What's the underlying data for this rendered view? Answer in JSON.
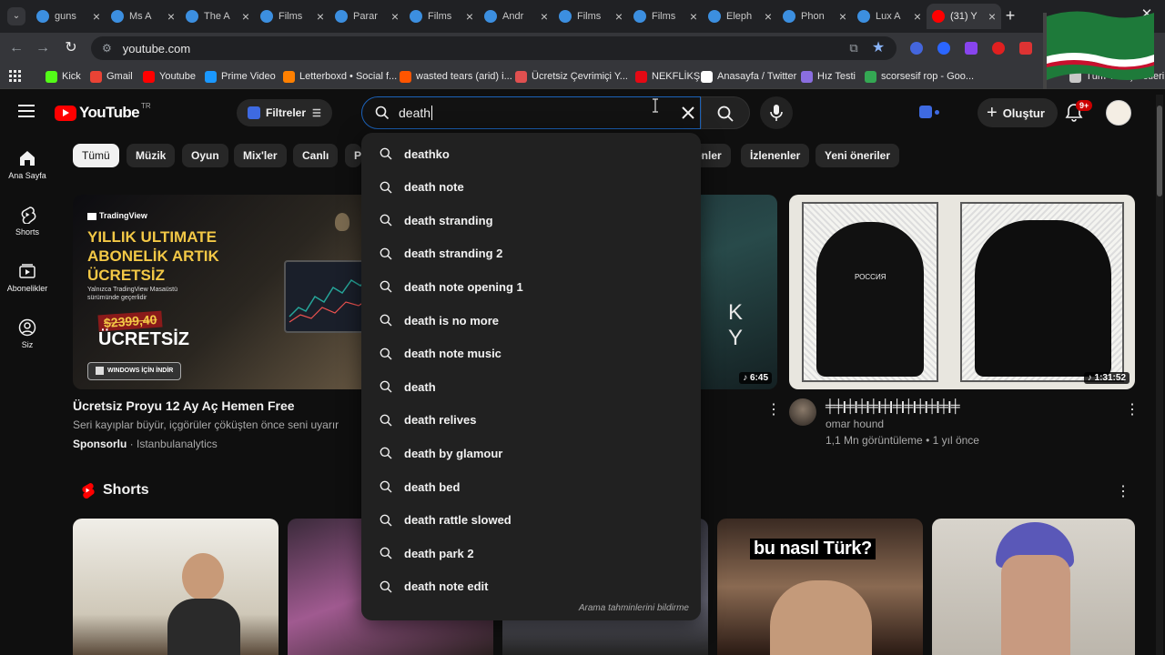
{
  "browser": {
    "tabs": [
      {
        "title": "guns",
        "color": "#3c8fe0"
      },
      {
        "title": "Ms A",
        "color": "#3c8fe0"
      },
      {
        "title": "The A",
        "color": "#3c8fe0"
      },
      {
        "title": "Films",
        "color": "#3c8fe0"
      },
      {
        "title": "Parar",
        "color": "#3c8fe0"
      },
      {
        "title": "Films",
        "color": "#3c8fe0"
      },
      {
        "title": "Andr",
        "color": "#3c8fe0"
      },
      {
        "title": "Films",
        "color": "#3c8fe0"
      },
      {
        "title": "Films",
        "color": "#3c8fe0"
      },
      {
        "title": "Eleph",
        "color": "#3c8fe0"
      },
      {
        "title": "Phon",
        "color": "#3c8fe0"
      },
      {
        "title": "Lux A",
        "color": "#3c8fe0"
      },
      {
        "title": "(31) Y",
        "color": "#ff0000",
        "active": true
      }
    ],
    "address": "youtube.com",
    "bookmarks": [
      {
        "label": "Kick",
        "color": "#53fc18"
      },
      {
        "label": "Gmail",
        "color": "#ea4335"
      },
      {
        "label": "Youtube",
        "color": "#ff0000"
      },
      {
        "label": "Prime Video",
        "color": "#1a98ff"
      },
      {
        "label": "Letterboxd • Social f...",
        "color": "#ff8000"
      },
      {
        "label": "wasted tears (arid) i...",
        "color": "#ff5500"
      },
      {
        "label": "Ücretsiz Çevrimiçi Y...",
        "color": "#e05050"
      },
      {
        "label": "NEKFLİKŞ",
        "color": "#e50914"
      },
      {
        "label": "Anasayfa / Twitter",
        "color": "#ffffff"
      },
      {
        "label": "Hız Testi",
        "color": "#8a6ee0"
      },
      {
        "label": "scorsesif rop - Goo...",
        "color": "#34a853"
      }
    ],
    "other_bookmarks": "Tüm Yer İşaretleri"
  },
  "youtube": {
    "logo_word": "YouTube",
    "country": "TR",
    "filter_label": "Filtreler",
    "search_query": "death",
    "create_label": "Oluştur",
    "notif_badge": "9+",
    "sidenav": [
      {
        "label": "Ana Sayfa",
        "icon": "home-icon"
      },
      {
        "label": "Shorts",
        "icon": "shorts-icon"
      },
      {
        "label": "Abonelikler",
        "icon": "subscriptions-icon"
      },
      {
        "label": "Siz",
        "icon": "you-icon"
      }
    ],
    "chips": [
      "Tümü",
      "Müzik",
      "Oyun",
      "Mix'ler",
      "Canlı",
      "P"
    ],
    "chips_right": [
      "enler",
      "İzlenenler",
      "Yeni öneriler"
    ],
    "suggestions": [
      "deathko",
      "death note",
      "death stranding",
      "death stranding 2",
      "death note opening 1",
      "death is no more",
      "death note music",
      "death",
      "death relives",
      "death by glamour",
      "death bed",
      "death rattle slowed",
      "death park 2",
      "death note edit"
    ],
    "report_link": "Arama tahminlerini bildirme",
    "ad": {
      "brand": "TradingView",
      "headline_1": "YILLIK ULTIMATE",
      "headline_2": "ABONELİK ARTIK",
      "headline_3": "ÜCRETSİZ",
      "sub_1": "Yalnızca TradingView Masaüstü",
      "sub_2": "sürümünde geçerlidir",
      "old_price": "$2399,40",
      "free": "ÜCRETSİZ",
      "cta": "WINDOWS İÇİN İNDİR",
      "title": "Ücretsiz Proyu 12 Ay Aç Hemen Free",
      "desc": "Seri kayıplar büyür, içgörüler çöküşten önce seni uyarır",
      "sponsored": "Sponsorlu",
      "advertiser": "Istanbulanalytics"
    },
    "video_mid": {
      "duration": "6:45",
      "overlay_text": "K Y"
    },
    "video_right": {
      "duration": "1:31:52",
      "title": "╪╪|╪|╪|╪|╪|╪|╪|╪|╪|╪|╪",
      "channel": "omar hound",
      "stats": "1,1 Mn görüntüleme • 1 yıl önce",
      "stamp_text": "РОССИЯ"
    },
    "shorts_title": "Shorts",
    "shorts_overlay": "bu nasıl Türk?"
  }
}
